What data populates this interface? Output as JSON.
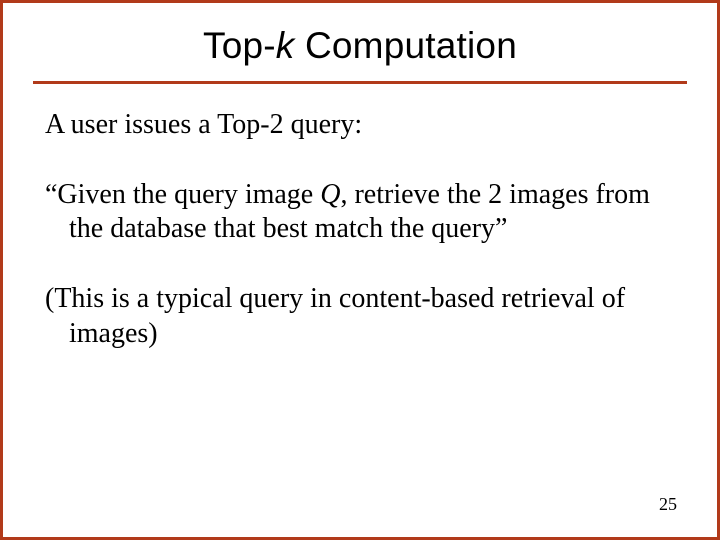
{
  "title": {
    "pre": "Top-",
    "k": "k",
    "post": " Computation"
  },
  "p1": "A user issues a Top-2 query:",
  "p2": {
    "open": "“Given the query image ",
    "q": "Q",
    "rest": ", retrieve the 2 images from the database that best match the query”"
  },
  "p3": "(This is a typical query in content-based retrieval of images)",
  "page_number": "25"
}
